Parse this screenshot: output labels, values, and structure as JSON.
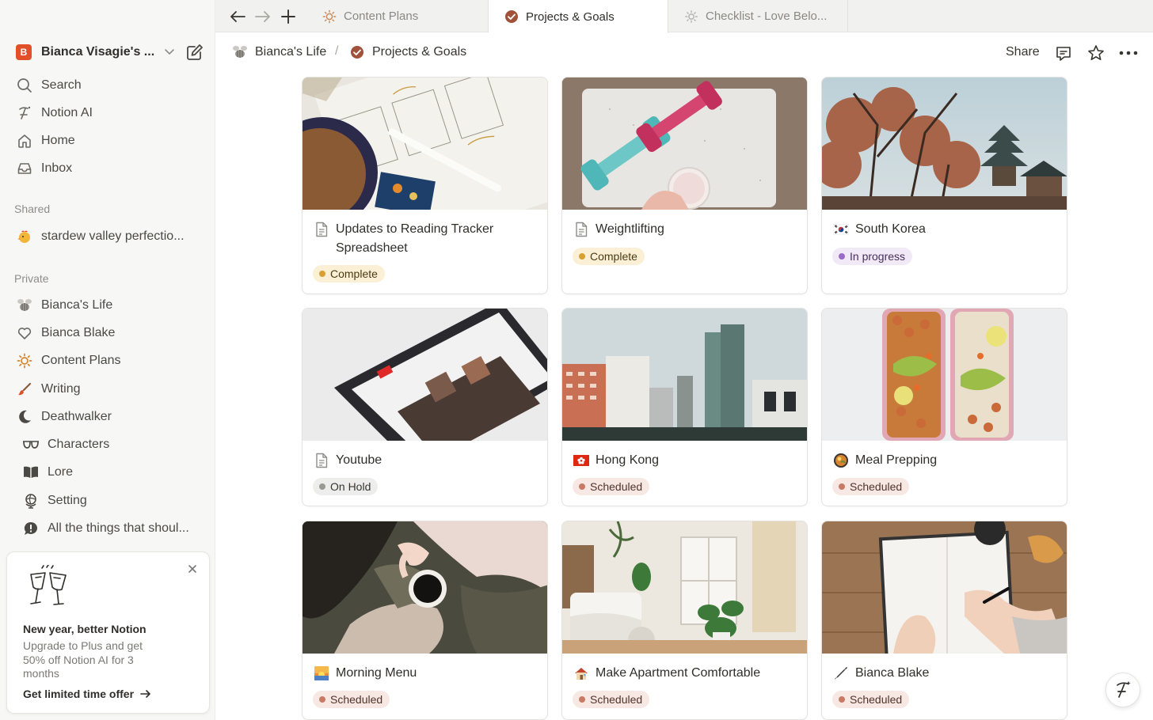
{
  "workspace": {
    "initial": "B",
    "name": "Bianca Visagie's ..."
  },
  "nav": {
    "search": "Search",
    "notion_ai": "Notion AI",
    "home": "Home",
    "inbox": "Inbox"
  },
  "shared": {
    "label": "Shared",
    "items": [
      {
        "label": "stardew valley perfectio...",
        "icon": "chicken-emoji"
      }
    ]
  },
  "private": {
    "label": "Private",
    "items": [
      {
        "label": "Bianca's Life",
        "icon": "bee-icon"
      },
      {
        "label": "Bianca Blake",
        "icon": "heart-icon"
      },
      {
        "label": "Content Plans",
        "icon": "sun-icon"
      },
      {
        "label": "Writing",
        "icon": "brush-icon"
      },
      {
        "label": "Deathwalker",
        "icon": "moon-icon"
      },
      {
        "label": "Characters",
        "icon": "glasses-icon"
      },
      {
        "label": "Lore",
        "icon": "book-icon"
      },
      {
        "label": "Setting",
        "icon": "globe-icon"
      },
      {
        "label": "All the things that shoul...",
        "icon": "alert-icon"
      }
    ]
  },
  "promo": {
    "title": "New year, better Notion",
    "body": "Upgrade to Plus and get 50% off Notion AI for 3 months",
    "cta": "Get limited time offer"
  },
  "tabs": [
    {
      "label": "Content Plans",
      "icon": "sun-icon",
      "active": false
    },
    {
      "label": "Projects & Goals",
      "icon": "check-circle-icon",
      "active": true
    },
    {
      "label": "Checklist - Love Belo...",
      "icon": "sun-icon",
      "active": false
    }
  ],
  "breadcrumb": {
    "parent": "Bianca's Life",
    "separator": "/",
    "current": "Projects & Goals"
  },
  "header": {
    "share": "Share"
  },
  "cards": [
    {
      "title": "Updates to Reading Tracker Spreadsheet",
      "icon": "page-icon",
      "status": "Complete",
      "status_kind": "complete"
    },
    {
      "title": "Weightlifting",
      "icon": "page-icon",
      "status": "Complete",
      "status_kind": "complete"
    },
    {
      "title": "South Korea",
      "icon": "korea-flag-emoji",
      "status": "In progress",
      "status_kind": "progress"
    },
    {
      "title": "Youtube",
      "icon": "page-icon",
      "status": "On Hold",
      "status_kind": "hold"
    },
    {
      "title": "Hong Kong",
      "icon": "hong-kong-flag-emoji",
      "status": "Scheduled",
      "status_kind": "sched"
    },
    {
      "title": "Meal Prepping",
      "icon": "food-emoji",
      "status": "Scheduled",
      "status_kind": "sched"
    },
    {
      "title": "Morning Menu",
      "icon": "sunrise-emoji",
      "status": "Scheduled",
      "status_kind": "sched"
    },
    {
      "title": "Make Apartment Comfortable",
      "icon": "house-emoji",
      "status": "Scheduled",
      "status_kind": "sched"
    },
    {
      "title": "Bianca Blake",
      "icon": "pen-emoji",
      "status": "Scheduled",
      "status_kind": "sched"
    }
  ],
  "colors": {
    "sidebar_bg": "#f7f7f5",
    "complete": "#d8a032",
    "in_progress": "#9b6cc5",
    "on_hold": "#9a9994",
    "scheduled": "#c77b67"
  }
}
